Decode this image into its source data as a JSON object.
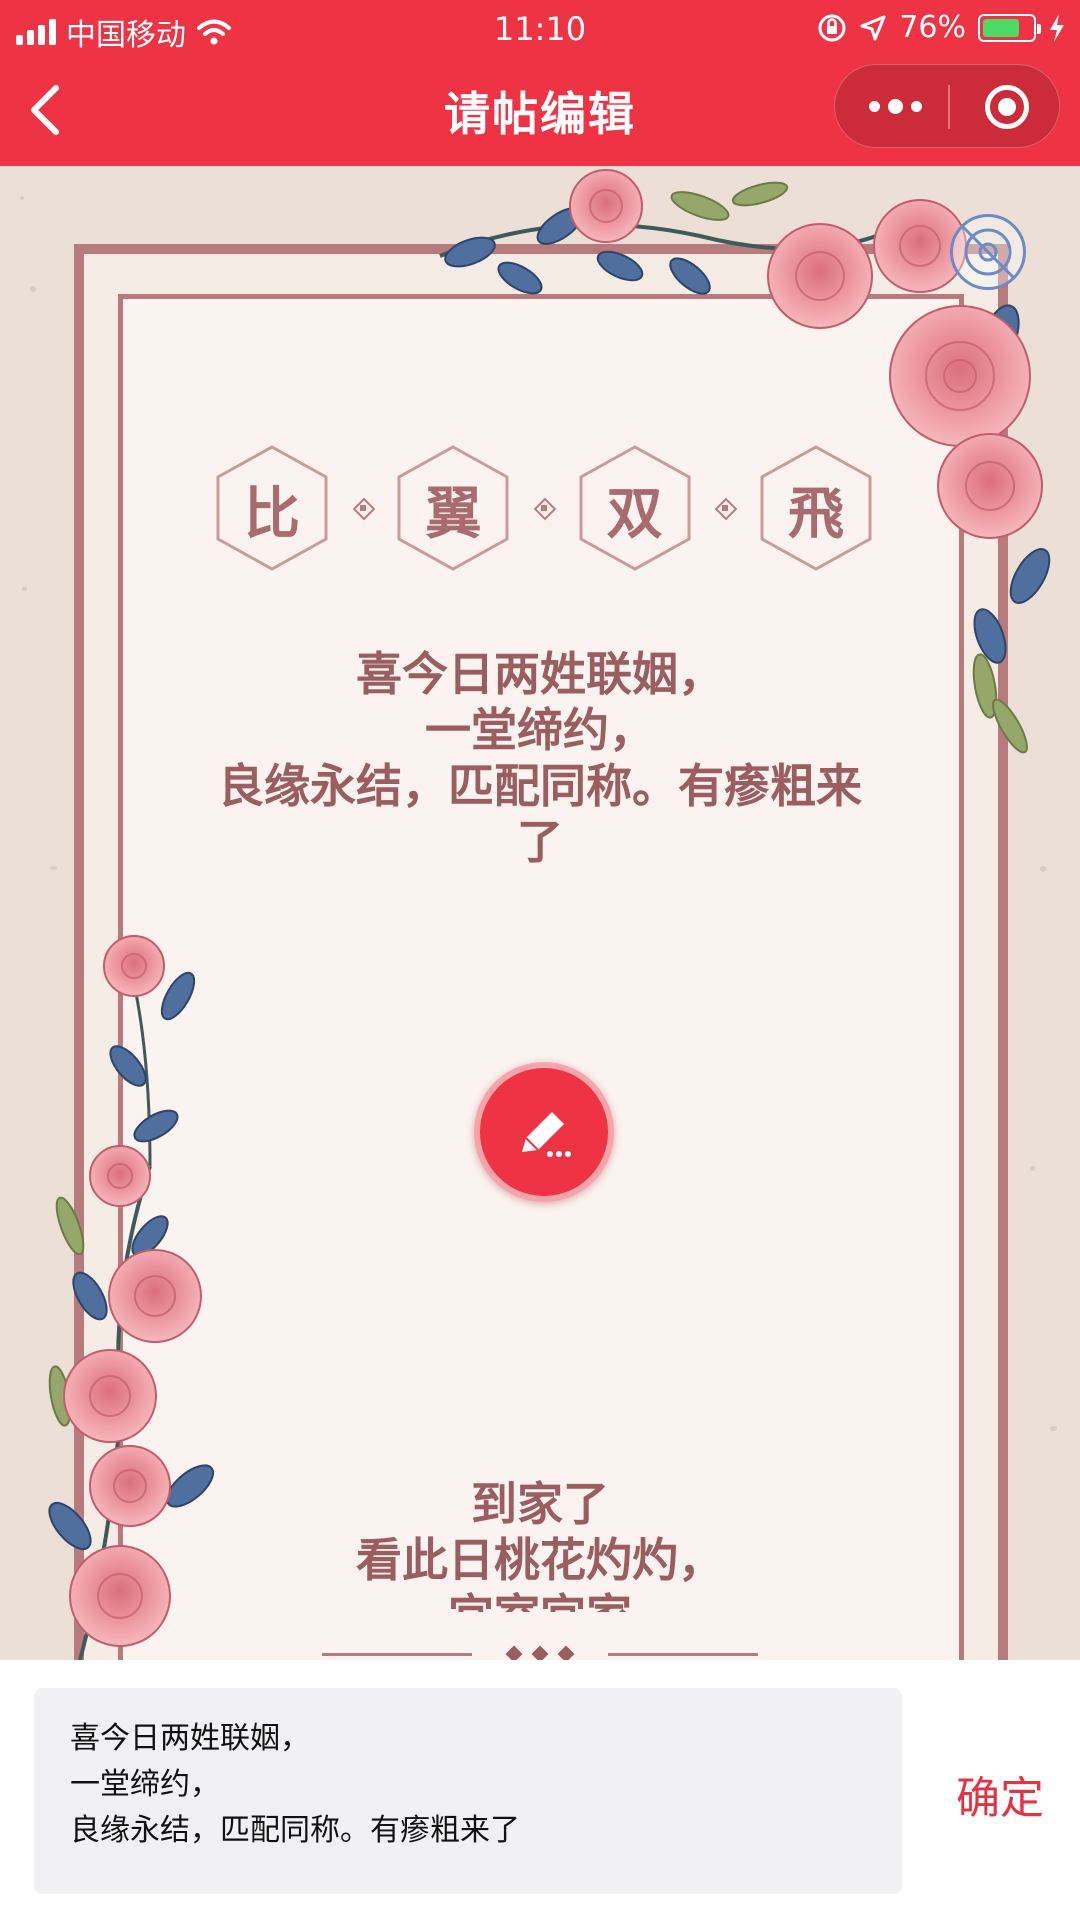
{
  "status_bar": {
    "carrier": "中国移动",
    "time": "11:10",
    "battery": "76%",
    "battery_level": 0.76,
    "icons": [
      "signal-icon",
      "wifi-icon",
      "rotation-lock-icon",
      "location-arrow-icon",
      "battery-icon",
      "charging-icon"
    ]
  },
  "nav": {
    "title": "请帖编辑",
    "icons": [
      "back-chevron-icon",
      "more-dots-icon",
      "close-target-icon"
    ]
  },
  "card": {
    "title_chars": [
      "比",
      "翼",
      "双",
      "飛"
    ],
    "verse_top": [
      "喜今日两姓联姻，",
      "一堂缔约，",
      "良缘永结，匹配同称。有瘆粗来",
      "了"
    ],
    "verse_bottom": [
      "到家了",
      "看此日桃花灼灼，",
      "宜室宜家"
    ],
    "icons": [
      "edit-pencil-icon",
      "rose-decoration-icon"
    ]
  },
  "editor": {
    "lines": [
      "喜今日两姓联姻，",
      "一堂缔约，",
      "良缘永结，匹配同称。有瘆粗来了"
    ],
    "confirm_label": "确定"
  },
  "colors": {
    "accent": "#ee3344",
    "frame": "#b87b7d",
    "verse": "#9a5d60",
    "paper": "#ece0d6"
  }
}
